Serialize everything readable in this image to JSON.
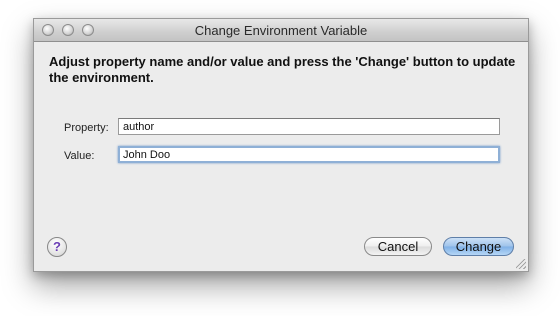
{
  "window": {
    "title": "Change Environment Variable"
  },
  "dialog": {
    "instructions": "Adjust property name and/or value and press the 'Change' button to update the environment.",
    "property_label": "Property:",
    "property_value": "author",
    "value_label": "Value:",
    "value_value": "John Doo"
  },
  "buttons": {
    "help_label": "?",
    "cancel_label": "Cancel",
    "change_label": "Change"
  },
  "colors": {
    "window_bg": "#ececec",
    "default_button": "#9ec2ea",
    "focus_ring": "#8fb0d6",
    "help_glyph": "#6b3fb5"
  },
  "icons": {
    "close": "traffic-light-close-icon",
    "minimize": "traffic-light-minimize-icon",
    "zoom": "traffic-light-zoom-icon",
    "resize": "resize-grip-icon"
  }
}
